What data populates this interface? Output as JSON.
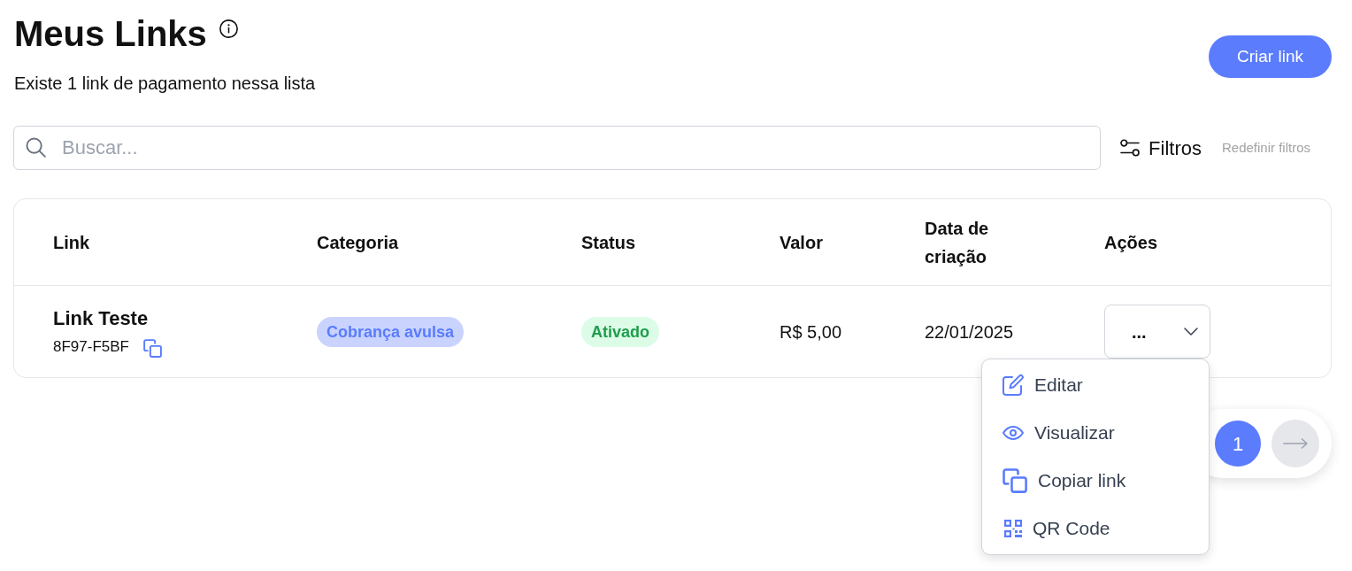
{
  "header": {
    "title": "Meus Links",
    "subtitle": "Existe 1 link de pagamento nessa lista",
    "create_button": "Criar link"
  },
  "search": {
    "placeholder": "Buscar..."
  },
  "filters": {
    "button": "Filtros",
    "reset": "Redefinir filtros"
  },
  "table": {
    "columns": [
      "Link",
      "Categoria",
      "Status",
      "Valor",
      "Data de criação",
      "Ações"
    ],
    "rows": [
      {
        "name": "Link Teste",
        "code": "8F97-F5BF",
        "category": "Cobrança avulsa",
        "status": {
          "label": "Ativado",
          "kind": "active"
        },
        "value": "R$ 5,00",
        "date": "22/01/2025",
        "actions": {
          "label": "...",
          "expanded": true,
          "items": [
            {
              "kind": "edit",
              "label": "Editar"
            },
            {
              "kind": "view",
              "label": "Visualizar"
            },
            {
              "kind": "copy",
              "label": "Copiar link"
            },
            {
              "kind": "qr",
              "label": "QR Code"
            }
          ]
        }
      }
    ]
  },
  "pagination": {
    "pages": [
      {
        "label": "1",
        "selected": true
      }
    ],
    "next": {
      "disabled": true
    }
  }
}
